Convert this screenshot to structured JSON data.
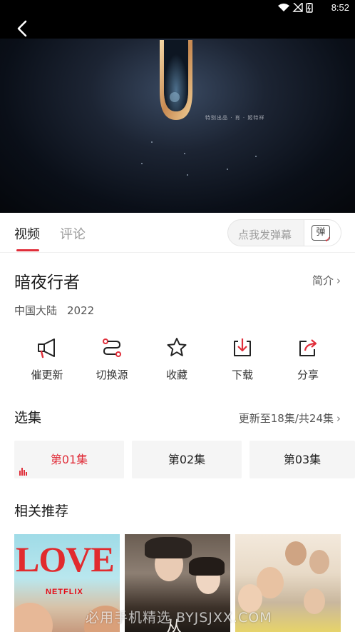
{
  "status_bar": {
    "time": "8:52"
  },
  "video": {
    "credit_text": "特别出品 · 肖 · 姬特祥"
  },
  "tabs": {
    "video": "视频",
    "comment": "评论"
  },
  "danmu": {
    "placeholder": "点我发弹幕",
    "button": "弹"
  },
  "show": {
    "title": "暗夜行者",
    "intro_label": "简介",
    "region": "中国大陆",
    "year": "2022"
  },
  "actions": [
    {
      "label": "催更新",
      "icon": "megaphone-icon"
    },
    {
      "label": "切换源",
      "icon": "switch-source-icon"
    },
    {
      "label": "收藏",
      "icon": "star-icon"
    },
    {
      "label": "下载",
      "icon": "download-icon"
    },
    {
      "label": "分享",
      "icon": "share-icon"
    }
  ],
  "episodes": {
    "section_title": "选集",
    "update_status": "更新至18集/共24集",
    "items": [
      "第01集",
      "第02集",
      "第03集"
    ],
    "active_index": 0
  },
  "recommendations": {
    "section_title": "相关推荐",
    "poster1_title": "LOVE",
    "poster1_brand": "NETFLIX",
    "poster2_title": "从"
  },
  "watermark": "必用手机精选 BYJSJXX.COM",
  "colors": {
    "accent": "#e02e3a",
    "video_bg": "#05070b"
  }
}
